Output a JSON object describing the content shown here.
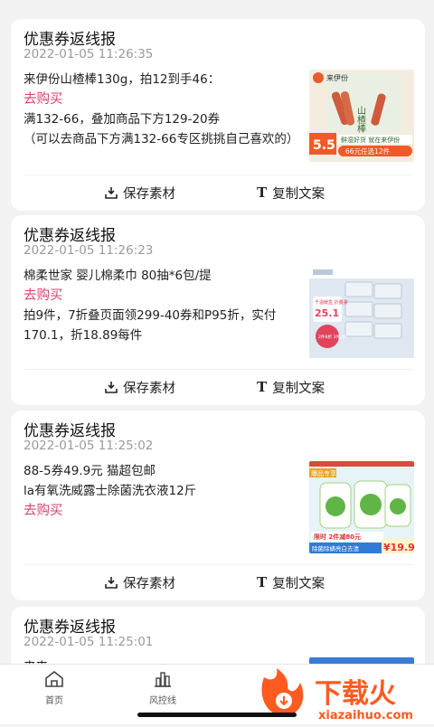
{
  "posts": [
    {
      "title": "优惠券返线报",
      "time": "2022-01-05 11:26:35",
      "lines": [
        "来伊份山楂棒130g，拍12到手46："
      ],
      "buy_label": "去购买",
      "after_lines": [
        "满132-66，叠加商品下方129-20券",
        "（可以去商品下方满132-66专区挑挑自己喜欢的）"
      ],
      "thumb": {
        "brand": "来伊份",
        "product": "山楂棒",
        "price": "5.5",
        "banner": "鲜湿好货 就在来伊份",
        "promo": "66元任选12件"
      }
    },
    {
      "title": "优惠券返线报",
      "time": "2022-01-05 11:26:23",
      "lines": [
        "棉柔世家 婴儿棉柔巾 80抽*6包/提"
      ],
      "buy_label": "去购买",
      "after_lines": [
        "拍9件，7折叠页面领299-40券和P95折，实付170.1，折18.89每件"
      ],
      "thumb": {
        "promo_top": "千温暖盒 折叠柔",
        "price": "25.1",
        "badge": "2件8折 3件7折"
      }
    },
    {
      "title": "优惠券返线报",
      "time": "2022-01-05 11:25:02",
      "lines": [
        "88-5券49.9元 猫超包邮",
        "la有氧洗威露士除菌洗衣液12斤"
      ],
      "buy_label": "去购买",
      "after_lines": [],
      "thumb": {
        "tag": "爆品专享",
        "promo": "限时 2件减80元",
        "strip": "除菌除螨亮白去渍",
        "price": "¥19.9"
      }
    },
    {
      "title": "优惠券返线报",
      "time": "2022-01-05 11:25:01",
      "lines": [
        "来来"
      ],
      "buy_label": "",
      "after_lines": []
    }
  ],
  "actions": {
    "save": "保存素材",
    "copy": "复制文案"
  },
  "tabs": [
    {
      "label": "首页"
    },
    {
      "label": "风控线"
    }
  ],
  "watermark": {
    "title": "下载火",
    "url": "xiazaihuo.com"
  },
  "colors": {
    "accent": "#d8436b",
    "background": "#f2f2f2",
    "watermark": "#ff5a1f"
  }
}
